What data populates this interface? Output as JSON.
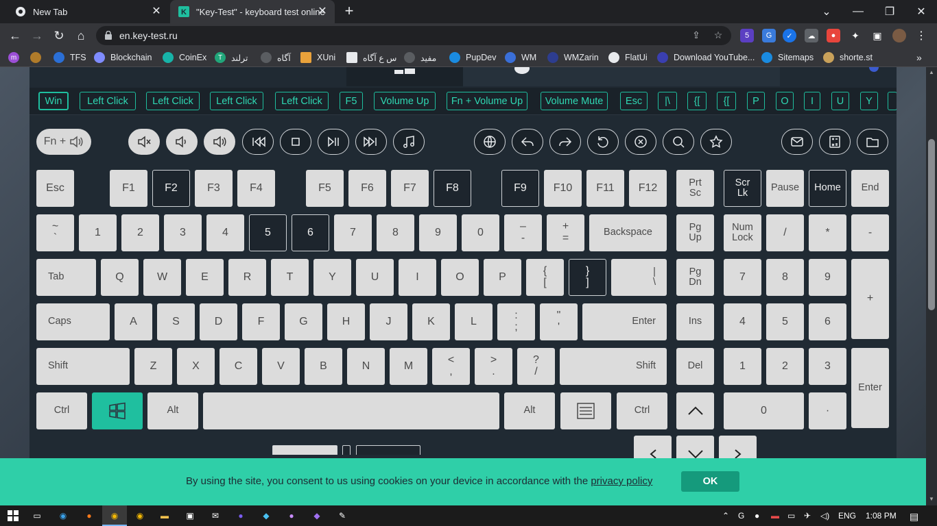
{
  "browser": {
    "tabs": [
      {
        "title": "New Tab",
        "icon": "chrome-icon"
      },
      {
        "title": "\"Key-Test\" - keyboard test online",
        "icon": "key-test-favicon"
      }
    ],
    "url": "en.key-test.ru",
    "extension_badge": "5",
    "bookmarks": [
      "TFS",
      "Blockchain",
      "CoinEx",
      "ترلند",
      "آگاه",
      "XUni",
      "س ع آگاه",
      "مفید",
      "PupDev",
      "WM",
      "WMZarin",
      "FlatUi",
      "Download YouTube...",
      "Sitemaps",
      "shorte.st"
    ]
  },
  "history": [
    "Win",
    "Left Click",
    "Left Click",
    "Left Click",
    "Left Click",
    "F5",
    "Volume Up",
    "Fn + Volume Up",
    "Volume Mute",
    "Esc",
    "|\\",
    "{[",
    "{[",
    "P",
    "O",
    "I",
    "U",
    "Y",
    ""
  ],
  "media": {
    "fn_label": "Fn +"
  },
  "keys": {
    "esc": "Esc",
    "f1": "F1",
    "f2": "F2",
    "f3": "F3",
    "f4": "F4",
    "f5": "F5",
    "f6": "F6",
    "f7": "F7",
    "f8": "F8",
    "f9": "F9",
    "f10": "F10",
    "f11": "F11",
    "f12": "F12",
    "prt_a": "Prt",
    "prt_b": "Sc",
    "scr_a": "Scr",
    "scr_b": "Lk",
    "pause": "Pause",
    "home": "Home",
    "end": "End",
    "tilde_a": "~",
    "tilde_b": "`",
    "n1": "1",
    "n2": "2",
    "n3": "3",
    "n4": "4",
    "n5": "5",
    "n6": "6",
    "n7": "7",
    "n8": "8",
    "n9": "9",
    "n0": "0",
    "minus_a": "–",
    "minus_b": "-",
    "plus_a": "+",
    "plus_b": "=",
    "backspace": "Backspace",
    "pgup_a": "Pg",
    "pgup_b": "Up",
    "num_a": "Num",
    "num_b": "Lock",
    "np_div": "/",
    "np_mul": "*",
    "np_sub": "-",
    "tab": "Tab",
    "q": "Q",
    "w": "W",
    "e": "E",
    "r": "R",
    "t": "T",
    "y": "Y",
    "u": "U",
    "i": "I",
    "o": "O",
    "p": "P",
    "lbr_a": "{",
    "lbr_b": "[",
    "rbr_a": "}",
    "rbr_b": "]",
    "bsl_a": "|",
    "bsl_b": "\\",
    "pgdn_a": "Pg",
    "pgdn_b": "Dn",
    "np7": "7",
    "np8": "8",
    "np9": "9",
    "np_add": "+",
    "caps": "Caps",
    "a": "A",
    "s": "S",
    "d": "D",
    "f": "F",
    "g": "G",
    "h": "H",
    "j": "J",
    "k": "K",
    "l": "L",
    "semi_a": ":",
    "semi_b": ";",
    "quote_a": "\"",
    "quote_b": "'",
    "enter": "Enter",
    "ins": "Ins",
    "np4": "4",
    "np5": "5",
    "np6": "6",
    "lshift": "Shift",
    "z": "Z",
    "x": "X",
    "c": "C",
    "v": "V",
    "b": "B",
    "n": "N",
    "m": "M",
    "comma_a": "<",
    "comma_b": ",",
    "period_a": ">",
    "period_b": ".",
    "slash_a": "?",
    "slash_b": "/",
    "rshift": "Shift",
    "del": "Del",
    "np1": "1",
    "np2": "2",
    "np3": "3",
    "np_enter": "Enter",
    "lctrl": "Ctrl",
    "lalt": "Alt",
    "ralt": "Alt",
    "rctrl": "Ctrl",
    "np0": "0",
    "np_dot": "·"
  },
  "cookie": {
    "message": "By using the site, you consent to us using cookies on your device in accordance with the",
    "link": "privacy policy",
    "ok": "OK"
  },
  "taskbar": {
    "lang": "ENG",
    "time": "1:08 PM"
  },
  "colors": {
    "accent": "#1fbf9f",
    "key": "#dcdcdc",
    "key_pressed_dark": "#1d252d",
    "board": "#202a33",
    "cookie_bg": "#2fcfa8"
  }
}
